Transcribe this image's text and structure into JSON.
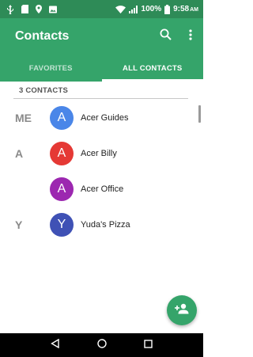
{
  "status_bar": {
    "battery": "100%",
    "time": "9:58",
    "ampm": "AM",
    "icons": [
      "usb-icon",
      "sd-card-icon",
      "location-icon",
      "image-icon",
      "wifi-icon",
      "signal-icon",
      "battery-icon"
    ]
  },
  "app_bar": {
    "title": "Contacts",
    "actions": [
      "search-icon",
      "more-vert-icon"
    ]
  },
  "tabs": [
    {
      "label": "FAVORITES",
      "active": false
    },
    {
      "label": "ALL CONTACTS",
      "active": true
    }
  ],
  "list": {
    "count_label": "3 CONTACTS",
    "contacts": [
      {
        "index": "ME",
        "initial": "A",
        "name": "Acer Guides",
        "color": "#4a86e8"
      },
      {
        "index": "A",
        "initial": "A",
        "name": "Acer Billy",
        "color": "#e53935"
      },
      {
        "index": "",
        "initial": "A",
        "name": "Acer Office",
        "color": "#9c27b0"
      },
      {
        "index": "Y",
        "initial": "Y",
        "name": "Yuda's Pizza",
        "color": "#3f51b5"
      }
    ]
  },
  "fab": {
    "icon": "add-person-icon"
  },
  "nav_bar": {
    "buttons": [
      "back-icon",
      "home-icon",
      "recents-icon"
    ]
  },
  "colors": {
    "primary": "#35a46a",
    "status_bar": "#2e8b57"
  }
}
